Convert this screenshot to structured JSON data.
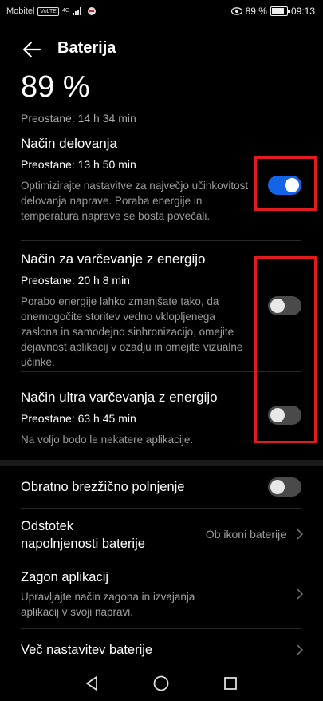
{
  "status_bar": {
    "carrier": "Mobitel",
    "badge": "VoLTE",
    "network": "4G",
    "battery_text": "89 %",
    "battery_level": 0.89,
    "time": "09:13"
  },
  "header": {
    "title": "Baterija"
  },
  "battery": {
    "percent": "89 %",
    "remaining": "Preostane: 14 h 34 min"
  },
  "modes": [
    {
      "title": "Način delovanja",
      "remaining": "Preostane: 13 h 50 min",
      "description": "Optimizirajte nastavitve za največjo učinkovitost delovanja naprave. Poraba energije in temperatura naprave se bosta povečali.",
      "enabled": true
    },
    {
      "title": "Način za varčevanje z energijo",
      "remaining": "Preostane: 20 h 8 min",
      "description": "Porabo energije lahko zmanjšate tako, da onemogočite storitev vedno vklopljenega zaslona in samodejno sinhronizacijo, omejite dejavnost aplikacij v ozadju in omejite vizualne učinke.",
      "enabled": false
    },
    {
      "title": "Način ultra varčevanja z energijo",
      "remaining": "Preostane: 63 h 45 min",
      "description": "Na voljo bodo le nekatere aplikacije.",
      "enabled": false
    }
  ],
  "settings": {
    "reverse_charging": {
      "label": "Obratno brezžično polnjenje",
      "enabled": false
    },
    "percentage": {
      "label_line1": "Odstotek",
      "label_line2": "napolnjenosti baterije",
      "value": "Ob ikoni baterije"
    },
    "app_launch": {
      "label": "Zagon aplikacij",
      "desc_line1": "Upravljajte način zagona in izvajanja",
      "desc_line2": "aplikacij v svoji napravi."
    },
    "more": {
      "label": "Več nastavitev baterije"
    }
  },
  "colors": {
    "accent": "#1464e8",
    "highlight": "#e01c1c"
  }
}
